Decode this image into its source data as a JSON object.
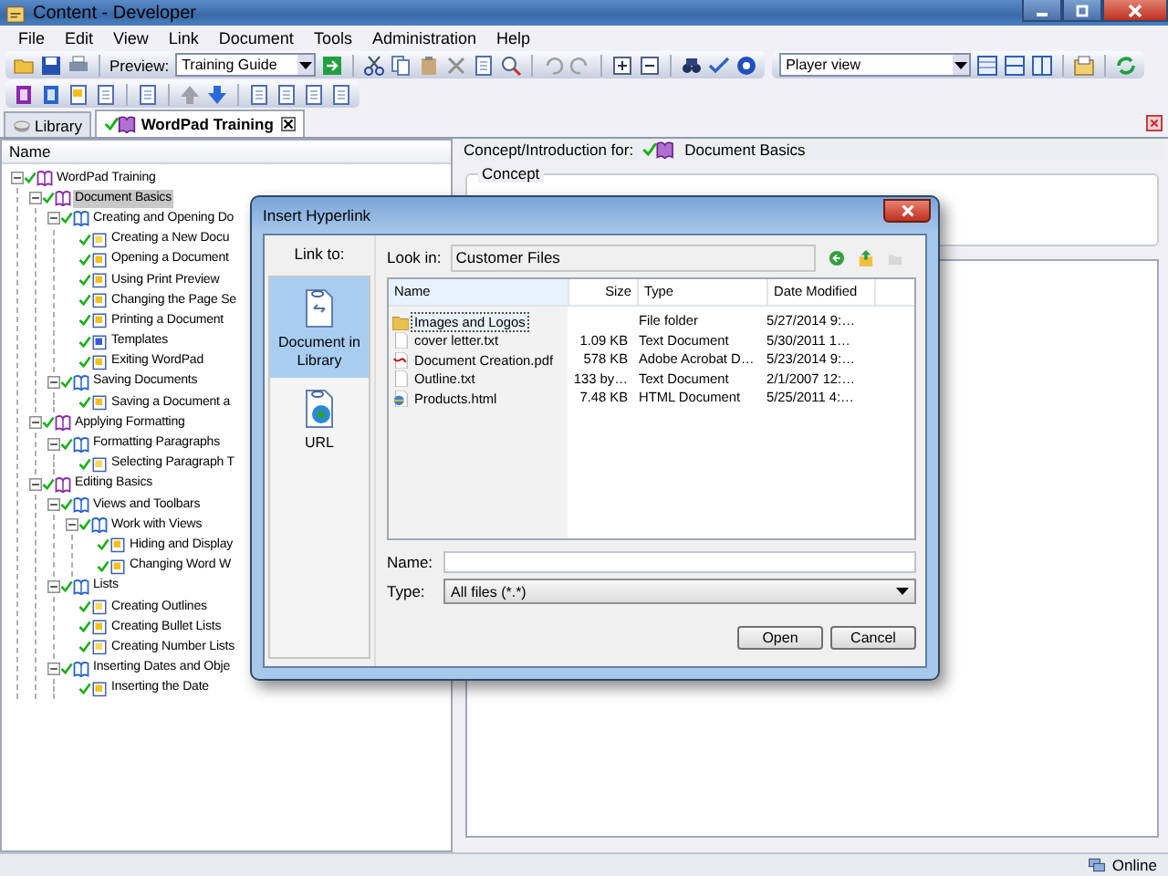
{
  "window": {
    "title": "Content - Developer"
  },
  "menu": [
    "File",
    "Edit",
    "View",
    "Link",
    "Document",
    "Tools",
    "Administration",
    "Help"
  ],
  "toolbar": {
    "preview_label": "Preview:",
    "preview_value": "Training Guide",
    "view_value": "Player view"
  },
  "tabs": [
    {
      "label": "Library",
      "selected": false
    },
    {
      "label": "WordPad Training",
      "selected": true
    }
  ],
  "tree": {
    "column": "Name",
    "items": [
      {
        "label": "WordPad Training",
        "kind": "module",
        "expanded": true,
        "selected": false,
        "children": [
          {
            "label": "Document Basics",
            "kind": "module",
            "expanded": true,
            "selected": true,
            "children": [
              {
                "label": "Creating and Opening Do",
                "kind": "section",
                "expanded": true,
                "selected": false,
                "children": [
                  {
                    "label": "Creating a New Docu",
                    "kind": "concept",
                    "selected": false
                  },
                  {
                    "label": "Opening a Document",
                    "kind": "topic",
                    "selected": false
                  },
                  {
                    "label": "Using Print Preview",
                    "kind": "topic",
                    "selected": false
                  },
                  {
                    "label": "Changing the Page Se",
                    "kind": "topic",
                    "selected": false
                  },
                  {
                    "label": "Printing a Document",
                    "kind": "topic",
                    "selected": false
                  },
                  {
                    "label": "Templates",
                    "kind": "template",
                    "selected": false
                  },
                  {
                    "label": "Exiting WordPad",
                    "kind": "topic",
                    "selected": false
                  }
                ]
              },
              {
                "label": "Saving Documents",
                "kind": "section",
                "expanded": true,
                "selected": false,
                "children": [
                  {
                    "label": "Saving a Document a",
                    "kind": "topic",
                    "selected": false
                  }
                ]
              }
            ]
          },
          {
            "label": "Applying Formatting",
            "kind": "module",
            "expanded": true,
            "selected": false,
            "children": [
              {
                "label": "Formatting Paragraphs",
                "kind": "section",
                "expanded": true,
                "selected": false,
                "children": [
                  {
                    "label": "Selecting Paragraph T",
                    "kind": "concept",
                    "selected": false
                  }
                ]
              }
            ]
          },
          {
            "label": "Editing Basics",
            "kind": "module",
            "expanded": true,
            "selected": false,
            "children": [
              {
                "label": "Views and Toolbars",
                "kind": "section",
                "expanded": true,
                "selected": false,
                "children": [
                  {
                    "label": "Work with Views",
                    "kind": "section",
                    "expanded": true,
                    "selected": false,
                    "children": [
                      {
                        "label": "Hiding and Display",
                        "kind": "topic",
                        "selected": false
                      },
                      {
                        "label": "Changing Word W",
                        "kind": "topic",
                        "selected": false
                      }
                    ]
                  }
                ]
              },
              {
                "label": "Lists",
                "kind": "section",
                "expanded": true,
                "selected": false,
                "children": [
                  {
                    "label": "Creating Outlines",
                    "kind": "concept",
                    "selected": false
                  },
                  {
                    "label": "Creating Bullet Lists",
                    "kind": "topic",
                    "selected": false
                  },
                  {
                    "label": "Creating Number Lists",
                    "kind": "concept",
                    "selected": false
                  }
                ]
              },
              {
                "label": "Inserting Dates and Obje",
                "kind": "section",
                "expanded": true,
                "selected": false,
                "children": [
                  {
                    "label": "Inserting the Date",
                    "kind": "topic",
                    "selected": false
                  }
                ]
              }
            ]
          }
        ]
      }
    ]
  },
  "details": {
    "header_label": "Concept/Introduction for:",
    "header_item": "Document Basics",
    "section": "Concept"
  },
  "dialog": {
    "title": "Insert Hyperlink",
    "link_to_label": "Link to:",
    "link_targets": [
      {
        "label": "Document in Library",
        "kind": "document",
        "selected": true
      },
      {
        "label": "URL",
        "kind": "url",
        "selected": false
      }
    ],
    "look_in_label": "Look in:",
    "look_in_value": "Customer Files",
    "columns": [
      "Name",
      "Size",
      "Type",
      "Date Modified"
    ],
    "files": [
      {
        "name": "Images and Logos",
        "type": "File folder",
        "date": "5/27/2014 9:…",
        "kind": "folder",
        "selected": true
      },
      {
        "name": "cover letter.txt",
        "size": "1.09 KB",
        "type": "Text Document",
        "date": "5/30/2011 1…",
        "kind": "text",
        "selected": false
      },
      {
        "name": "Document Creation.pdf",
        "size": "578 KB",
        "type": "Adobe Acrobat D…",
        "date": "5/23/2014 9:…",
        "kind": "pdf",
        "selected": false
      },
      {
        "name": "Outline.txt",
        "size": "133 by…",
        "type": "Text Document",
        "date": "2/1/2007 12:…",
        "kind": "text",
        "selected": false
      },
      {
        "name": "Products.html",
        "size": "7.48 KB",
        "type": "HTML Document",
        "date": "5/25/2011 4:…",
        "kind": "html",
        "selected": false
      }
    ],
    "name_label": "Name:",
    "type_label": "Type:",
    "type_value": "All files (*.*)",
    "buttons": [
      "Open",
      "Cancel"
    ]
  },
  "status_bar": {
    "text": "Online"
  }
}
